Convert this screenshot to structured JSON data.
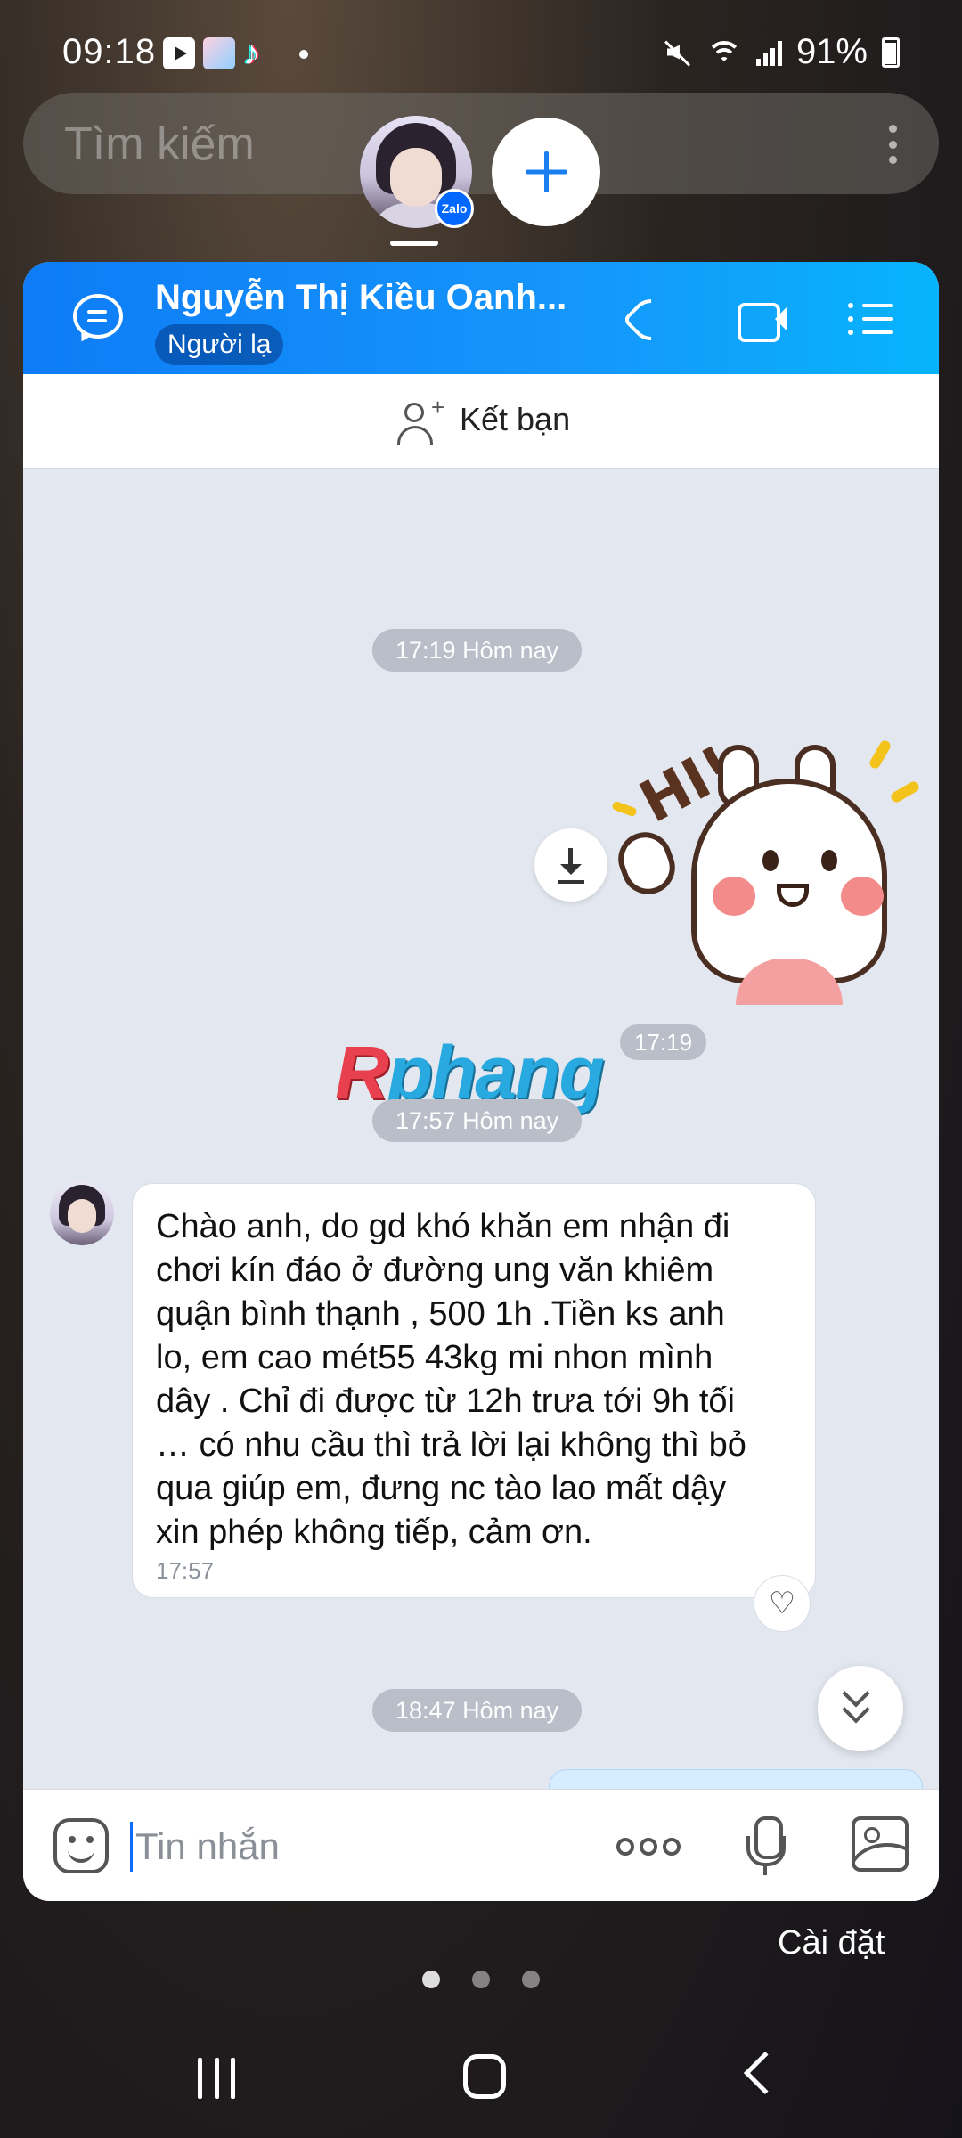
{
  "status_bar": {
    "time": "09:18",
    "battery": "91%",
    "notification_icons": [
      "youtube-icon",
      "app-icon",
      "tiktok-icon"
    ]
  },
  "search": {
    "placeholder": "Tìm kiếm"
  },
  "bubble": {
    "badge": "Zalo"
  },
  "chat": {
    "contact_name": "Nguyễn Thị Kiều Oanh...",
    "contact_tag": "Người lạ",
    "add_friend_label": "Kết bạn",
    "accent_color": "#0e7cf6",
    "messages": [
      {
        "type": "timestamp",
        "text": "17:19 Hôm nay"
      },
      {
        "type": "sticker",
        "sender": "self",
        "sticker_text": "HI!",
        "time": "17:19"
      },
      {
        "type": "timestamp",
        "text": "17:57 Hôm nay"
      },
      {
        "type": "text",
        "sender": "contact",
        "text": "Chào anh,  do gd khó khăn em nhận đi\nchơi kín đáo ở đường ung văn khiêm\nquận bình thạnh , 500 1h .Tiền ks anh\nlo, em cao mét55 43kg mi nhon mình\ndây . Chỉ đi được từ 12h trưa tới 9h tối\n… có nhu cầu thì trả lời lại không thì bỏ\nqua giúp em, đưng nc tào lao mất dậy\nxin phép không tiếp, cảm ơn.",
        "time": "17:57"
      },
      {
        "type": "timestamp",
        "text": "18:47 Hôm nay"
      }
    ],
    "composer_placeholder": "Tin nhắn"
  },
  "watermark": {
    "first_letter": "R",
    "rest": "phang"
  },
  "settings_label": "Cài đặt"
}
